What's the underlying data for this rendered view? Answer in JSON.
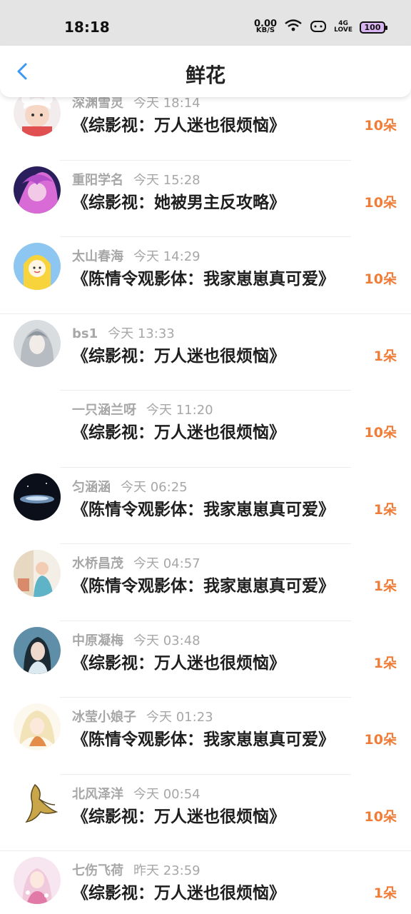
{
  "status": {
    "time": "18:18",
    "speed_value": "0.00",
    "speed_unit": "KB/S",
    "network_top": "4G",
    "network_bottom": "LOVE",
    "battery": "100"
  },
  "header": {
    "title": "鲜花"
  },
  "colors": {
    "accent_blue": "#3a9af3",
    "count_orange": "#ef7c37",
    "meta_gray": "#a7a7a7"
  },
  "items": [
    {
      "name": "深渊雪灵",
      "time": "今天 18:14",
      "book": "《综影视：万人迷也很烦恼》",
      "count": "10朵"
    },
    {
      "name": "重阳学名",
      "time": "今天 15:28",
      "book": "《综影视：她被男主反攻略》",
      "count": "10朵"
    },
    {
      "name": "太山春海",
      "time": "今天 14:29",
      "book": "《陈情令观影体：我家崽崽真可爱》",
      "count": "10朵"
    },
    {
      "name": "bs1",
      "time": "今天 13:33",
      "book": "《综影视：万人迷也很烦恼》",
      "count": "1朵"
    },
    {
      "name": "一只涵兰呀",
      "time": "今天 11:20",
      "book": "《综影视：万人迷也很烦恼》",
      "count": "10朵"
    },
    {
      "name": "匀涵涵",
      "time": "今天 06:25",
      "book": "《陈情令观影体：我家崽崽真可爱》",
      "count": "1朵"
    },
    {
      "name": "水桥昌茂",
      "time": "今天 04:57",
      "book": "《陈情令观影体：我家崽崽真可爱》",
      "count": "1朵"
    },
    {
      "name": "中原凝梅",
      "time": "今天 03:48",
      "book": "《综影视：万人迷也很烦恼》",
      "count": "1朵"
    },
    {
      "name": "冰莹小娘子",
      "time": "今天 01:23",
      "book": "《陈情令观影体：我家崽崽真可爱》",
      "count": "10朵"
    },
    {
      "name": "北风泽洋",
      "time": "今天 00:54",
      "book": "《综影视：万人迷也很烦恼》",
      "count": "10朵"
    },
    {
      "name": "七伤飞荷",
      "time": "昨天 23:59",
      "book": "《综影视：万人迷也很烦恼》",
      "count": "1朵"
    }
  ]
}
